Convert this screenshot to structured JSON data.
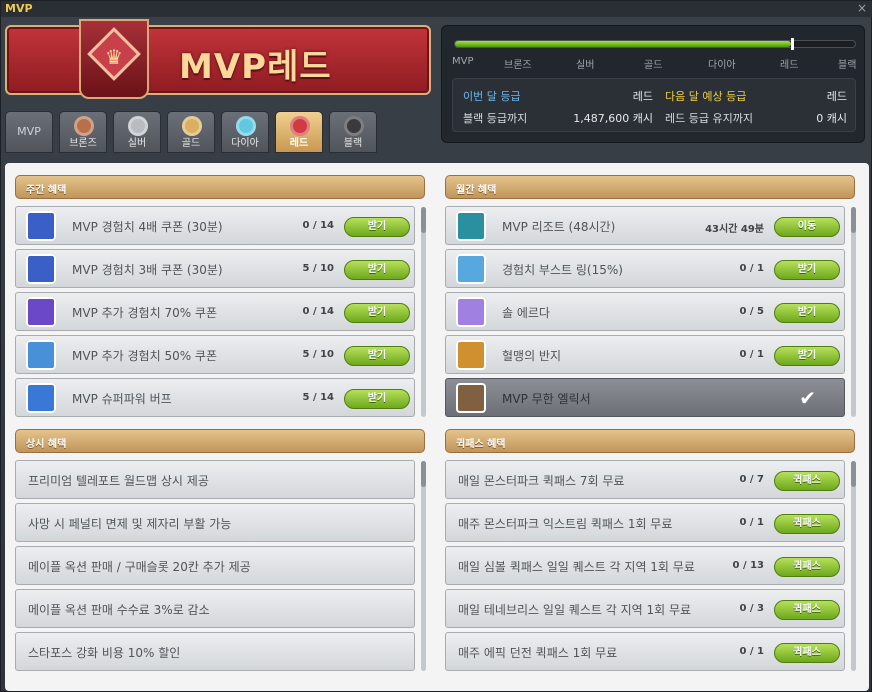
{
  "window": {
    "title": "MVP",
    "close_glyph": "×"
  },
  "banner": {
    "title": "MVP레드",
    "medal_icon": "red-medal-icon"
  },
  "tabs": [
    {
      "label": "MVP",
      "icon": "",
      "color": "#6b7078"
    },
    {
      "label": "브론즈",
      "icon": "bronze-medal-icon",
      "color": "#b8704a"
    },
    {
      "label": "실버",
      "icon": "silver-medal-icon",
      "color": "#b8bcc0"
    },
    {
      "label": "골드",
      "icon": "gold-medal-icon",
      "color": "#d8b060"
    },
    {
      "label": "다이아",
      "icon": "diamond-medal-icon",
      "color": "#60c8e0"
    },
    {
      "label": "레드",
      "icon": "red-medal-icon",
      "color": "#d03a40",
      "active": true
    },
    {
      "label": "블랙",
      "icon": "black-medal-icon",
      "color": "#3a3a3e"
    }
  ],
  "status": {
    "progress": 0.84,
    "grades": [
      "MVP",
      "브론즈",
      "실버",
      "골드",
      "다이아",
      "레드",
      "블랙"
    ],
    "this_month_label": "이번 달 등급",
    "this_month_value": "레드",
    "next_month_label": "다음 달 예상 등급",
    "next_month_value": "레드",
    "to_black_label": "블랙 등급까지",
    "to_black_value": "1,487,600 캐시",
    "keep_red_label": "레드 등급 유지까지",
    "keep_red_value": "0 캐시"
  },
  "weekly": {
    "title": "주간 혜택",
    "rows": [
      {
        "text": "MVP 경험치 4배 쿠폰 (30분)",
        "count": "0 / 14",
        "button": "받기",
        "icon": "exp-coupon-icon"
      },
      {
        "text": "MVP 경험치 3배 쿠폰 (30분)",
        "count": "5 / 10",
        "button": "받기",
        "icon": "exp-coupon-icon"
      },
      {
        "text": "MVP 추가 경험치 70% 쿠폰",
        "count": "0 / 14",
        "button": "받기",
        "icon": "bonus-exp-coupon-icon"
      },
      {
        "text": "MVP 추가 경험치 50% 쿠폰",
        "count": "5 / 10",
        "button": "받기",
        "icon": "bonus-exp-coupon-icon"
      },
      {
        "text": "MVP 슈퍼파워 버프",
        "count": "5 / 14",
        "button": "받기",
        "icon": "superpower-buff-icon"
      }
    ]
  },
  "monthly": {
    "title": "월간 혜택",
    "rows": [
      {
        "text": "MVP 리조트 (48시간)",
        "count": "43시간 49분",
        "button": "이동",
        "icon": "resort-icon"
      },
      {
        "text": "경험치 부스트 링(15%)",
        "count": "0 / 1",
        "button": "받기",
        "icon": "boost-ring-icon"
      },
      {
        "text": "솔 에르다",
        "count": "0 / 5",
        "button": "받기",
        "icon": "sol-erda-icon"
      },
      {
        "text": "혈맹의 반지",
        "count": "0 / 1",
        "button": "받기",
        "icon": "blood-ring-icon"
      },
      {
        "text": "MVP 무한 엘릭서",
        "count": "",
        "button": "",
        "icon": "elixir-icon",
        "done": true
      }
    ]
  },
  "permanent": {
    "title": "상시 혜택",
    "rows": [
      {
        "text": "프리미엄 텔레포트 월드맵 상시 제공"
      },
      {
        "text": "사망 시 페널티 면제 및 제자리 부활 가능"
      },
      {
        "text": "메이플 옥션 판매 / 구매슬롯 20칸 추가 제공"
      },
      {
        "text": "메이플 옥션 판매 수수료 3%로 감소"
      },
      {
        "text": "스타포스 강화 비용 10% 할인"
      }
    ]
  },
  "quickpass": {
    "title": "퀵패스 혜택",
    "rows": [
      {
        "text": "매일 몬스터파크 퀵패스 7회 무료",
        "count": "0 / 7",
        "button": "퀵패스"
      },
      {
        "text": "매주 몬스터파크 익스트림 퀵패스 1회 무료",
        "count": "0 / 1",
        "button": "퀵패스"
      },
      {
        "text": "매일 심볼 퀵패스 일일 퀘스트 각 지역 1회 무료",
        "count": "0 / 13",
        "button": "퀵패스"
      },
      {
        "text": "매일 테네브리스 일일 퀘스트 각 지역 1회 무료",
        "count": "0 / 3",
        "button": "퀵패스"
      },
      {
        "text": "매주 에픽 던전 퀵패스 1회 무료",
        "count": "0 / 1",
        "button": "퀵패스"
      }
    ]
  },
  "colors": {
    "accent_blue": "#6ab8f0",
    "accent_yellow": "#f0d040",
    "check": "✔"
  }
}
